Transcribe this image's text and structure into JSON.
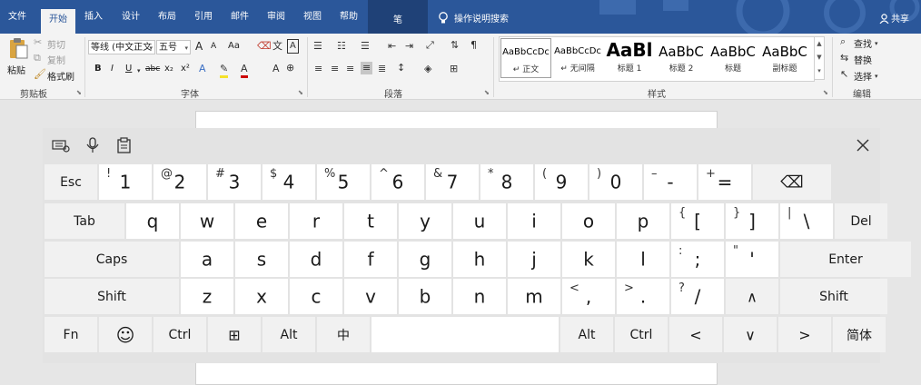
{
  "ribbon_tabs": [
    {
      "label": "文件"
    },
    {
      "label": "开始"
    },
    {
      "label": "插入"
    },
    {
      "label": "设计"
    },
    {
      "label": "布局"
    },
    {
      "label": "引用"
    },
    {
      "label": "邮件"
    },
    {
      "label": "审阅"
    },
    {
      "label": "视图"
    },
    {
      "label": "帮助"
    }
  ],
  "pen_tab": {
    "label": "笔"
  },
  "tell_me": {
    "label": "操作说明搜索"
  },
  "share": {
    "label": "共享"
  },
  "clipboard": {
    "paste": "粘贴",
    "cut": "剪切",
    "copy": "复制",
    "format_painter": "格式刷",
    "group": "剪贴板"
  },
  "font": {
    "name": "等线 (中文正文",
    "size": "五号",
    "grow": "A",
    "shrink": "A",
    "change_case": "Aa",
    "bold": "B",
    "italic": "I",
    "underline": "U",
    "strike": "abc",
    "subscript": "x₂",
    "superscript": "x²",
    "group": "字体"
  },
  "paragraph": {
    "group": "段落"
  },
  "styles": {
    "group": "样式",
    "items": [
      {
        "preview": "AaBbCcDc",
        "name": "↵ 正文"
      },
      {
        "preview": "AaBbCcDc",
        "name": "↵ 无间隔"
      },
      {
        "preview": "AaBl",
        "name": "标题 1"
      },
      {
        "preview": "AaBbC",
        "name": "标题 2"
      },
      {
        "preview": "AaBbC",
        "name": "标题"
      },
      {
        "preview": "AaBbC",
        "name": "副标题"
      }
    ]
  },
  "editing": {
    "find": "查找",
    "replace": "替换",
    "select": "选择",
    "group": "编辑"
  },
  "keyboard": {
    "rows": [
      [
        {
          "name": "esc",
          "main": "Esc",
          "func": true
        },
        {
          "name": "1",
          "main": "1",
          "sec": "!"
        },
        {
          "name": "2",
          "main": "2",
          "sec": "@"
        },
        {
          "name": "3",
          "main": "3",
          "sec": "#"
        },
        {
          "name": "4",
          "main": "4",
          "sec": "$"
        },
        {
          "name": "5",
          "main": "5",
          "sec": "%"
        },
        {
          "name": "6",
          "main": "6",
          "sec": "^"
        },
        {
          "name": "7",
          "main": "7",
          "sec": "&"
        },
        {
          "name": "8",
          "main": "8",
          "sec": "*"
        },
        {
          "name": "9",
          "main": "9",
          "sec": "("
        },
        {
          "name": "0",
          "main": "0",
          "sec": ")"
        },
        {
          "name": "minus",
          "main": "-",
          "sec": "–"
        },
        {
          "name": "equals",
          "main": "=",
          "sec": "+"
        },
        {
          "name": "backspace",
          "main": "⌫",
          "func": true
        }
      ],
      [
        {
          "name": "tab",
          "main": "Tab",
          "func": true
        },
        {
          "name": "q",
          "main": "q"
        },
        {
          "name": "w",
          "main": "w"
        },
        {
          "name": "e",
          "main": "e"
        },
        {
          "name": "r",
          "main": "r"
        },
        {
          "name": "t",
          "main": "t"
        },
        {
          "name": "y",
          "main": "y"
        },
        {
          "name": "u",
          "main": "u"
        },
        {
          "name": "i",
          "main": "i"
        },
        {
          "name": "o",
          "main": "o"
        },
        {
          "name": "p",
          "main": "p"
        },
        {
          "name": "left-bracket",
          "main": "[",
          "sec": "{"
        },
        {
          "name": "right-bracket",
          "main": "]",
          "sec": "}"
        },
        {
          "name": "backslash",
          "main": "\\",
          "sec": "|"
        },
        {
          "name": "del",
          "main": "Del",
          "func": true
        }
      ],
      [
        {
          "name": "caps",
          "main": "Caps",
          "func": true
        },
        {
          "name": "a",
          "main": "a"
        },
        {
          "name": "s",
          "main": "s"
        },
        {
          "name": "d",
          "main": "d"
        },
        {
          "name": "f",
          "main": "f"
        },
        {
          "name": "g",
          "main": "g"
        },
        {
          "name": "h",
          "main": "h"
        },
        {
          "name": "j",
          "main": "j"
        },
        {
          "name": "k",
          "main": "k"
        },
        {
          "name": "l",
          "main": "l"
        },
        {
          "name": "semicolon",
          "main": ";",
          "sec": ":"
        },
        {
          "name": "quote",
          "main": "'",
          "sec": "\""
        },
        {
          "name": "enter",
          "main": "Enter",
          "func": true
        }
      ],
      [
        {
          "name": "shift-left",
          "main": "Shift",
          "func": true
        },
        {
          "name": "z",
          "main": "z"
        },
        {
          "name": "x",
          "main": "x"
        },
        {
          "name": "c",
          "main": "c"
        },
        {
          "name": "v",
          "main": "v"
        },
        {
          "name": "b",
          "main": "b"
        },
        {
          "name": "n",
          "main": "n"
        },
        {
          "name": "m",
          "main": "m"
        },
        {
          "name": "comma",
          "main": ",",
          "sec": "<"
        },
        {
          "name": "period",
          "main": ".",
          "sec": ">"
        },
        {
          "name": "slash",
          "main": "/",
          "sec": "?"
        },
        {
          "name": "up",
          "main": "∧",
          "func": true
        },
        {
          "name": "shift-right",
          "main": "Shift",
          "func": true
        }
      ],
      [
        {
          "name": "fn",
          "main": "Fn",
          "func": true
        },
        {
          "name": "emoji",
          "main": "☺",
          "func": true
        },
        {
          "name": "ctrl-left",
          "main": "Ctrl",
          "func": true
        },
        {
          "name": "windows",
          "main": "⊞",
          "func": true
        },
        {
          "name": "alt-left",
          "main": "Alt",
          "func": true
        },
        {
          "name": "ime",
          "main": "中",
          "func": true
        },
        {
          "name": "space",
          "main": ""
        },
        {
          "name": "alt-right",
          "main": "Alt",
          "func": true
        },
        {
          "name": "ctrl-right",
          "main": "Ctrl",
          "func": true
        },
        {
          "name": "left",
          "main": "<",
          "func": true
        },
        {
          "name": "down",
          "main": "∨",
          "func": true
        },
        {
          "name": "right",
          "main": ">",
          "func": true
        },
        {
          "name": "lang",
          "main": "简体",
          "func": true
        }
      ]
    ]
  }
}
